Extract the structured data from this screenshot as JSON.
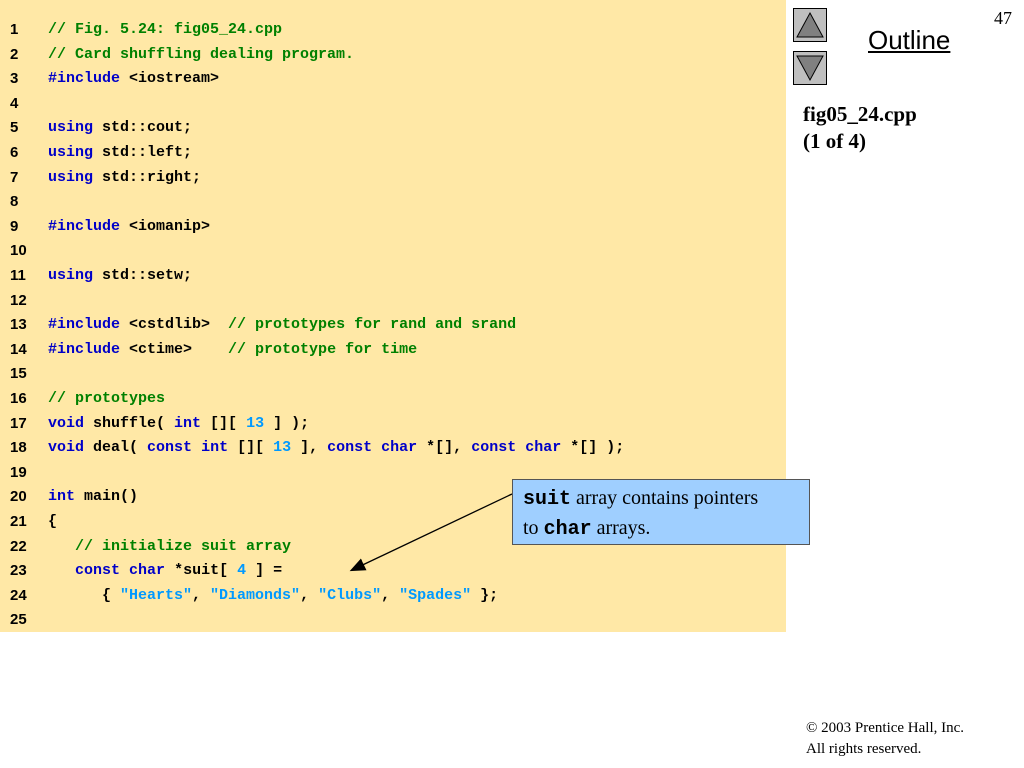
{
  "page_number": "47",
  "outline_label": "Outline",
  "file_title": {
    "name": "fig05_24.cpp",
    "part": "(1 of 4)"
  },
  "nav": {
    "up": "triangle-up-icon",
    "down": "triangle-down-icon"
  },
  "code_lines": [
    {
      "num": "1",
      "tokens": [
        {
          "t": "// Fig. 5.24: fig05_24.cpp",
          "c": "c"
        }
      ]
    },
    {
      "num": "2",
      "tokens": [
        {
          "t": "// Card shuffling dealing program.",
          "c": "c"
        }
      ]
    },
    {
      "num": "3",
      "tokens": [
        {
          "t": "#include",
          "c": "k"
        },
        {
          "t": " <iostream>",
          "c": ""
        }
      ]
    },
    {
      "num": "4",
      "tokens": []
    },
    {
      "num": "5",
      "tokens": [
        {
          "t": "using",
          "c": "k"
        },
        {
          "t": " std::cout;",
          "c": ""
        }
      ]
    },
    {
      "num": "6",
      "tokens": [
        {
          "t": "using",
          "c": "k"
        },
        {
          "t": " std::left;",
          "c": ""
        }
      ]
    },
    {
      "num": "7",
      "tokens": [
        {
          "t": "using",
          "c": "k"
        },
        {
          "t": " std::right;",
          "c": ""
        }
      ]
    },
    {
      "num": "8",
      "tokens": []
    },
    {
      "num": "9",
      "tokens": [
        {
          "t": "#include",
          "c": "k"
        },
        {
          "t": " <iomanip>",
          "c": ""
        }
      ]
    },
    {
      "num": "10",
      "tokens": []
    },
    {
      "num": "11",
      "tokens": [
        {
          "t": "using",
          "c": "k"
        },
        {
          "t": " std::setw;",
          "c": ""
        }
      ]
    },
    {
      "num": "12",
      "tokens": []
    },
    {
      "num": "13",
      "tokens": [
        {
          "t": "#include",
          "c": "k"
        },
        {
          "t": " <cstdlib>  ",
          "c": ""
        },
        {
          "t": "// prototypes for rand and srand",
          "c": "c"
        }
      ]
    },
    {
      "num": "14",
      "tokens": [
        {
          "t": "#include",
          "c": "k"
        },
        {
          "t": " <ctime>    ",
          "c": ""
        },
        {
          "t": "// prototype for time",
          "c": "c"
        }
      ]
    },
    {
      "num": "15",
      "tokens": []
    },
    {
      "num": "16",
      "tokens": [
        {
          "t": "// prototypes",
          "c": "c"
        }
      ]
    },
    {
      "num": "17",
      "tokens": [
        {
          "t": "void",
          "c": "k"
        },
        {
          "t": " shuffle( ",
          "c": ""
        },
        {
          "t": "int",
          "c": "k"
        },
        {
          "t": " [][ ",
          "c": ""
        },
        {
          "t": "13",
          "c": "n"
        },
        {
          "t": " ] );",
          "c": ""
        }
      ]
    },
    {
      "num": "18",
      "tokens": [
        {
          "t": "void",
          "c": "k"
        },
        {
          "t": " deal( ",
          "c": ""
        },
        {
          "t": "const",
          "c": "k"
        },
        {
          "t": " ",
          "c": ""
        },
        {
          "t": "int",
          "c": "k"
        },
        {
          "t": " [][ ",
          "c": ""
        },
        {
          "t": "13",
          "c": "n"
        },
        {
          "t": " ], ",
          "c": ""
        },
        {
          "t": "const",
          "c": "k"
        },
        {
          "t": " ",
          "c": ""
        },
        {
          "t": "char",
          "c": "k"
        },
        {
          "t": " *[], ",
          "c": ""
        },
        {
          "t": "const",
          "c": "k"
        },
        {
          "t": " ",
          "c": ""
        },
        {
          "t": "char",
          "c": "k"
        },
        {
          "t": " *[] );",
          "c": ""
        }
      ]
    },
    {
      "num": "19",
      "tokens": []
    },
    {
      "num": "20",
      "tokens": [
        {
          "t": "int",
          "c": "k"
        },
        {
          "t": " main()",
          "c": ""
        }
      ]
    },
    {
      "num": "21",
      "tokens": [
        {
          "t": "{",
          "c": ""
        }
      ]
    },
    {
      "num": "22",
      "tokens": [
        {
          "t": "   ",
          "c": ""
        },
        {
          "t": "// initialize suit array",
          "c": "c"
        }
      ]
    },
    {
      "num": "23",
      "tokens": [
        {
          "t": "   ",
          "c": ""
        },
        {
          "t": "const",
          "c": "k"
        },
        {
          "t": " ",
          "c": ""
        },
        {
          "t": "char",
          "c": "k"
        },
        {
          "t": " *suit[ ",
          "c": ""
        },
        {
          "t": "4",
          "c": "n"
        },
        {
          "t": " ] =",
          "c": ""
        }
      ]
    },
    {
      "num": "24",
      "tokens": [
        {
          "t": "      { ",
          "c": ""
        },
        {
          "t": "\"Hearts\"",
          "c": "s"
        },
        {
          "t": ", ",
          "c": ""
        },
        {
          "t": "\"Diamonds\"",
          "c": "s"
        },
        {
          "t": ", ",
          "c": ""
        },
        {
          "t": "\"Clubs\"",
          "c": "s"
        },
        {
          "t": ", ",
          "c": ""
        },
        {
          "t": "\"Spades\"",
          "c": "s"
        },
        {
          "t": " };",
          "c": ""
        }
      ]
    },
    {
      "num": "25",
      "tokens": []
    }
  ],
  "callout": {
    "term1": "suit",
    "text1": " array contains pointers",
    "text2": "to ",
    "term2": "char",
    "text3": " arrays."
  },
  "copyright": {
    "symbol": "©",
    "line1": " 2003 Prentice Hall, Inc.",
    "line2": "All rights reserved."
  },
  "colors": {
    "panel": "#ffe8a6",
    "comment": "#008000",
    "keyword": "#0000c8",
    "literal": "#0099ff",
    "callout": "#9fcfff"
  }
}
